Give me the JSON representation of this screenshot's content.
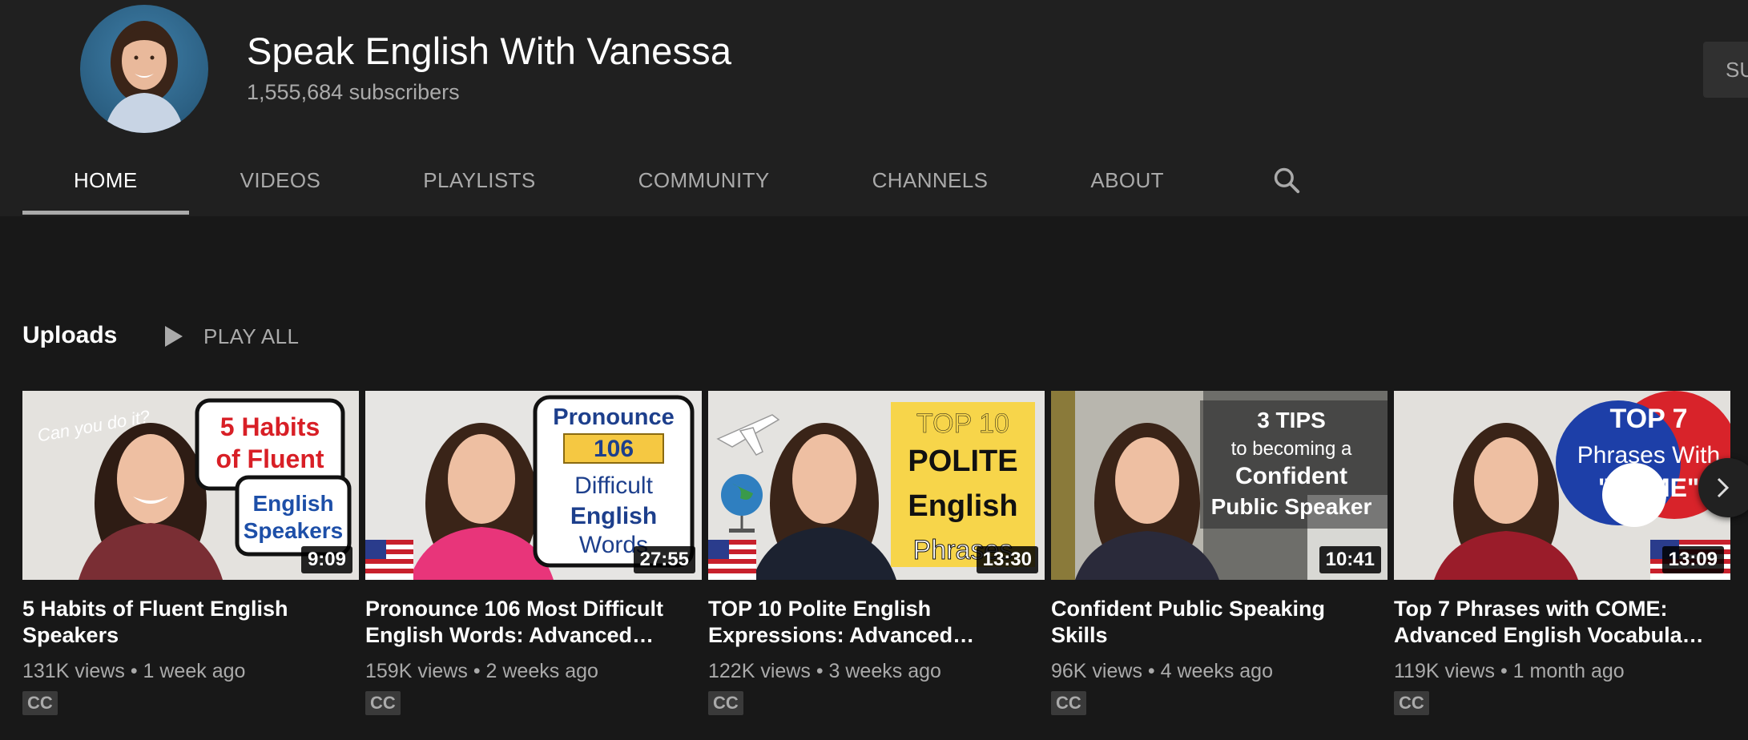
{
  "channel": {
    "name": "Speak English With Vanessa",
    "subscribers": "1,555,684 subscribers",
    "subscribe_label": "SU"
  },
  "tabs": [
    {
      "label": "HOME",
      "active": true
    },
    {
      "label": "VIDEOS",
      "active": false
    },
    {
      "label": "PLAYLISTS",
      "active": false
    },
    {
      "label": "COMMUNITY",
      "active": false
    },
    {
      "label": "CHANNELS",
      "active": false
    },
    {
      "label": "ABOUT",
      "active": false
    }
  ],
  "search_icon": "search-icon",
  "section": {
    "title": "Uploads",
    "play_all": "PLAY ALL"
  },
  "videos": [
    {
      "title": "5 Habits of Fluent English Speakers",
      "views": "131K views",
      "age": "1 week ago",
      "duration": "9:09",
      "badge": "CC",
      "thumb_text": [
        "Can you do it?",
        "5 Habits",
        "of Fluent",
        "English",
        "Speakers"
      ]
    },
    {
      "title": "Pronounce 106 Most Difficult English Words: Advanced…",
      "views": "159K views",
      "age": "2 weeks ago",
      "duration": "27:55",
      "badge": "CC",
      "thumb_text": [
        "Pronounce",
        "106",
        "Difficult",
        "English",
        "Words"
      ]
    },
    {
      "title": "TOP 10 Polite English Expressions: Advanced…",
      "views": "122K views",
      "age": "3 weeks ago",
      "duration": "13:30",
      "badge": "CC",
      "thumb_text": [
        "TOP 10",
        "POLITE",
        "English",
        "Phrases"
      ]
    },
    {
      "title": "Confident Public Speaking Skills",
      "views": "96K views",
      "age": "4 weeks ago",
      "duration": "10:41",
      "badge": "CC",
      "thumb_text": [
        "3 TIPS",
        "to becoming a",
        "Confident",
        "Public Speaker"
      ]
    },
    {
      "title": "Top 7 Phrases with COME: Advanced English Vocabula…",
      "views": "119K views",
      "age": "1 month ago",
      "duration": "13:09",
      "badge": "CC",
      "thumb_text": [
        "TOP 7",
        "Phrases With",
        "\"COME\""
      ]
    }
  ],
  "separator": "•",
  "colors": {
    "background": "#181818",
    "header": "#202020",
    "text_primary": "#ffffff",
    "text_secondary": "#aaaaaa"
  }
}
